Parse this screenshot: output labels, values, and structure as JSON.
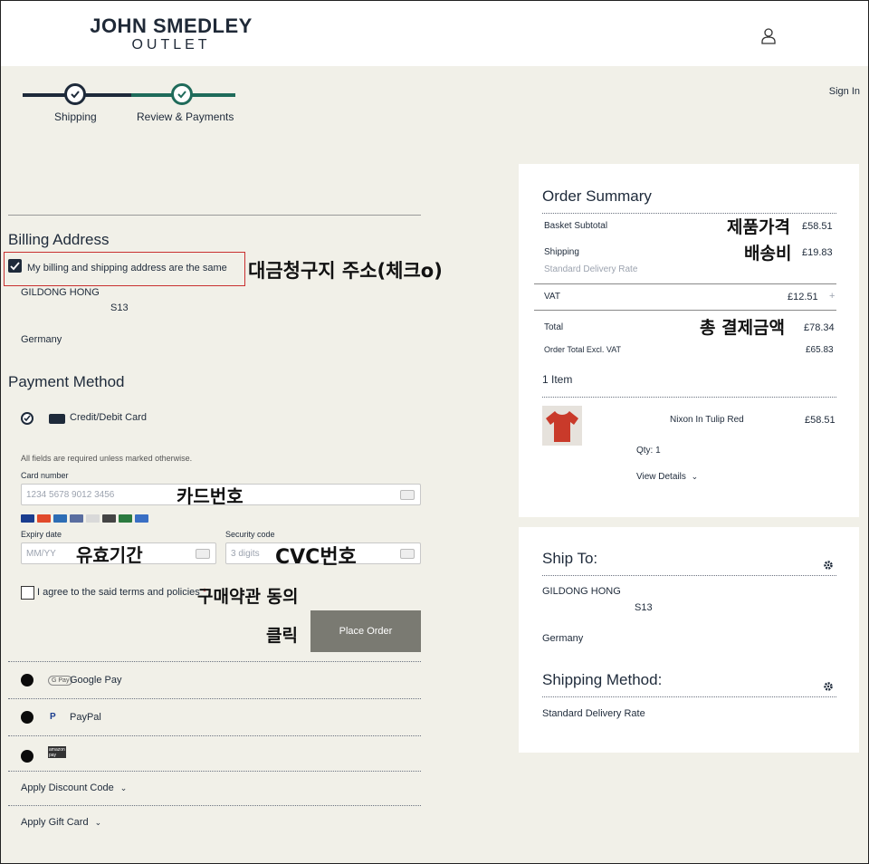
{
  "brand": {
    "line1": "JOHN SMEDLEY",
    "line2": "OUTLET"
  },
  "header": {
    "sign_in": "Sign In"
  },
  "progress": {
    "steps": [
      {
        "label": "Shipping"
      },
      {
        "label": "Review & Payments"
      }
    ]
  },
  "billing": {
    "title": "Billing Address",
    "same_address_label": "My billing and shipping address are the same",
    "name": "GILDONG HONG",
    "line2": "S13",
    "country": "Germany"
  },
  "payment": {
    "title": "Payment Method",
    "card_option": "Credit/Debit Card",
    "required_note": "All fields are required unless marked otherwise.",
    "card_number_label": "Card number",
    "card_number_placeholder": "1234 5678 9012 3456",
    "expiry_label": "Expiry date",
    "expiry_placeholder": "MM/YY",
    "security_label": "Security code",
    "security_placeholder": "3 digits",
    "terms_label": "I agree to the said terms and policies",
    "terms_required": "*",
    "place_order": "Place Order",
    "google_pay": "Google Pay",
    "google_pay_badge": "G Pay",
    "paypal": "PayPal",
    "paypal_badge": "P",
    "amazon_badge": "amazon pay",
    "discount": "Apply Discount Code",
    "gift": "Apply Gift Card"
  },
  "card_brands": [
    "VISA",
    "MC",
    "AMEX",
    "Diners",
    "Discover",
    "Maestro",
    "JCB",
    "UnionPay"
  ],
  "summary": {
    "title": "Order Summary",
    "basket_label": "Basket Subtotal",
    "basket_value": "£58.51",
    "shipping_label": "Shipping",
    "shipping_value": "£19.83",
    "shipping_method": "Standard Delivery Rate",
    "vat_label": "VAT",
    "vat_value": "£12.51",
    "vat_toggle": "+",
    "total_label": "Total",
    "total_value": "£78.34",
    "excl_label": "Order Total Excl. VAT",
    "excl_value": "£65.83",
    "items_count": "1 Item",
    "item_name": "Nixon In Tulip Red",
    "item_price": "£58.51",
    "item_qty": "Qty: 1",
    "view_details": "View Details"
  },
  "ship_to": {
    "title": "Ship To:",
    "name": "GILDONG HONG",
    "line2": "S13",
    "country": "Germany",
    "method_title": "Shipping Method:",
    "method": "Standard Delivery Rate"
  },
  "annotations": {
    "billing": "대금청구지 주소(체크o)",
    "card_number": "카드번호",
    "expiry": "유효기간",
    "cvc": "CVC번호",
    "terms": "구매약관 동의",
    "click": "클릭",
    "product_price": "제품가격",
    "shipping_fee": "배송비",
    "total": "총 결제금액"
  },
  "colors": {
    "accent_navy": "#1e2a3a",
    "accent_teal": "#1f6b5a",
    "highlight_red": "#c93030",
    "place_order_bg": "#7a7a72"
  }
}
